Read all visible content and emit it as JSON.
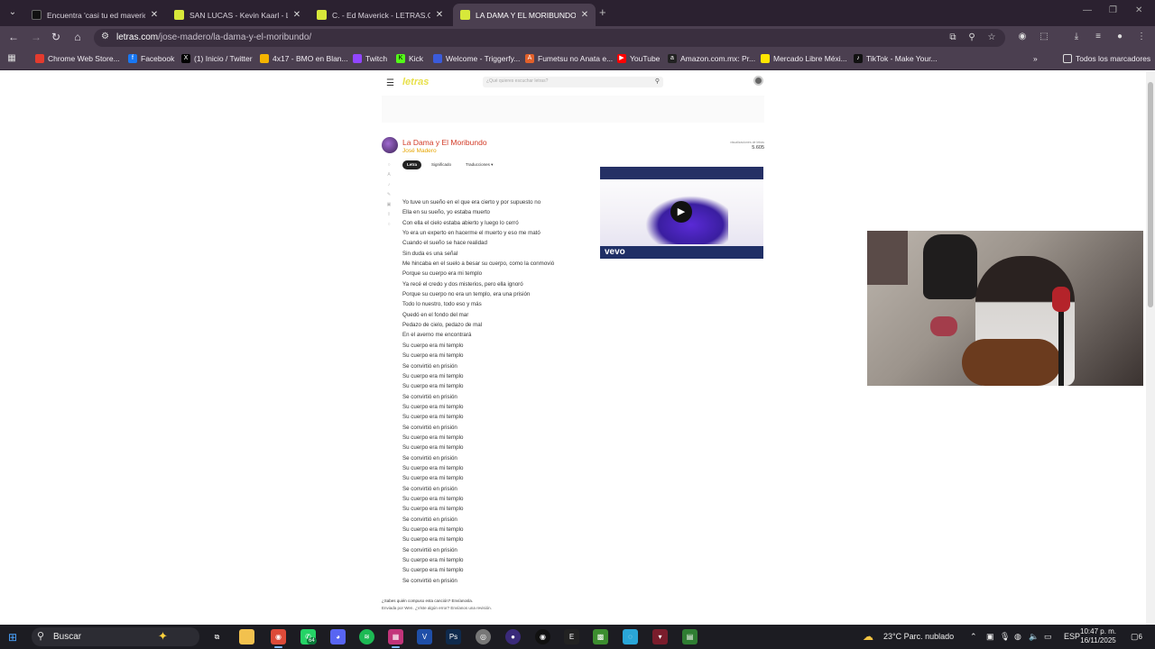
{
  "browser": {
    "tabs": [
      {
        "title": "Encuentra 'casi tu ed maverick",
        "favicon_color": "#111111"
      },
      {
        "title": "SAN LUCAS - Kevin Kaarl - LETR",
        "favicon_color": "#d7e83a"
      },
      {
        "title": "C. - Ed Maverick - LETRAS.COM",
        "favicon_color": "#d7e83a"
      },
      {
        "title": "LA DAMA Y EL MORIBUNDO - J",
        "favicon_color": "#d7e83a"
      }
    ],
    "url_domain": "letras.com",
    "url_path": "/jose-madero/la-dama-y-el-moribundo/",
    "bookmarks": [
      {
        "label": "Chrome Web Store...",
        "icon": "chrome-icon",
        "color": "#e33b2e"
      },
      {
        "label": "Facebook",
        "icon": "facebook-icon",
        "color": "#1877f2"
      },
      {
        "label": "(1) Inicio / Twitter",
        "icon": "x-icon",
        "color": "#000000"
      },
      {
        "label": "4x17 - BMO en Blan...",
        "icon": "bmo-icon",
        "color": "#f4b400"
      },
      {
        "label": "Twitch",
        "icon": "twitch-icon",
        "color": "#9146ff"
      },
      {
        "label": "Kick",
        "icon": "kick-icon",
        "color": "#53fc18"
      },
      {
        "label": "Welcome - Triggerfy...",
        "icon": "triggerfy-icon",
        "color": "#3b5bdb"
      },
      {
        "label": "Fumetsu no Anata e...",
        "icon": "af-icon",
        "color": "#e2602a"
      },
      {
        "label": "YouTube",
        "icon": "youtube-icon",
        "color": "#ff0000"
      },
      {
        "label": "Amazon.com.mx: Pr...",
        "icon": "amazon-icon",
        "color": "#222222"
      },
      {
        "label": "Mercado Libre Méxi...",
        "icon": "mercadolibre-icon",
        "color": "#ffe600"
      },
      {
        "label": "TikTok - Make Your...",
        "icon": "tiktok-icon",
        "color": "#111111"
      }
    ],
    "all_bookmarks": "Todos los marcadores"
  },
  "page": {
    "search_placeholder": "¿Qué quieres escuchar letras?",
    "song_title": "La Dama y El Moribundo",
    "artist": "José Madero",
    "views_label": "visualizaciones de letras",
    "views_count": "5.605",
    "tabs": [
      "Letra",
      "Significado",
      "Traducciones ▾"
    ],
    "lyrics": [
      "Yo tuve un sueño en el que era cierto y por supuesto no",
      "Ella en su sueño, yo estaba muerto",
      "Con ella el cielo estaba abierto y luego lo cerró",
      "Yo era un experto en hacerme el muerto y eso me mató",
      "Cuando el sueño se hace realidad",
      "Sin duda es una señal",
      "Me hincaba en el suelo a besar su cuerpo, como la conmovió",
      "Porque su cuerpo era mi templo",
      "Ya recé el credo y dos misterios, pero ella ignoró",
      "Porque su cuerpo no era un templo, era una prisión",
      "Todo lo nuestro, todo eso y más",
      "Quedó en el fondo del mar",
      "Pedazo de cielo, pedazo de mal",
      "En el averno me encontrará",
      "Su cuerpo era mi templo",
      "Su cuerpo era mi templo",
      "Se convirtió en prisión",
      "Su cuerpo era mi templo",
      "Su cuerpo era mi templo",
      "Se convirtió en prisión",
      "Su cuerpo era mi templo",
      "Su cuerpo era mi templo",
      "Se convirtió en prisión",
      "Su cuerpo era mi templo",
      "Su cuerpo era mi templo",
      "Se convirtió en prisión",
      "Su cuerpo era mi templo",
      "Su cuerpo era mi templo",
      "Se convirtió en prisión",
      "Su cuerpo era mi templo",
      "Su cuerpo era mi templo",
      "Se convirtió en prisión",
      "Su cuerpo era mi templo",
      "Su cuerpo era mi templo",
      "Se convirtió en prisión",
      "Su cuerpo era mi templo",
      "Su cuerpo era mi templo",
      "Se convirtió en prisión"
    ],
    "video_brand": "vevo",
    "footer_question": "¿Sabes quién compuso esta canción? Envíanosla.",
    "footer_sent": "Enviada por Wen. ¿Viste algún error? Envíanos una revisión."
  },
  "taskbar": {
    "search_label": "Buscar",
    "whatsapp_badge": "64",
    "weather": "23°C  Parc. nublado",
    "language": "ESP",
    "time": "10:47 p. m.",
    "date": "16/11/2025",
    "notifications": "6"
  }
}
